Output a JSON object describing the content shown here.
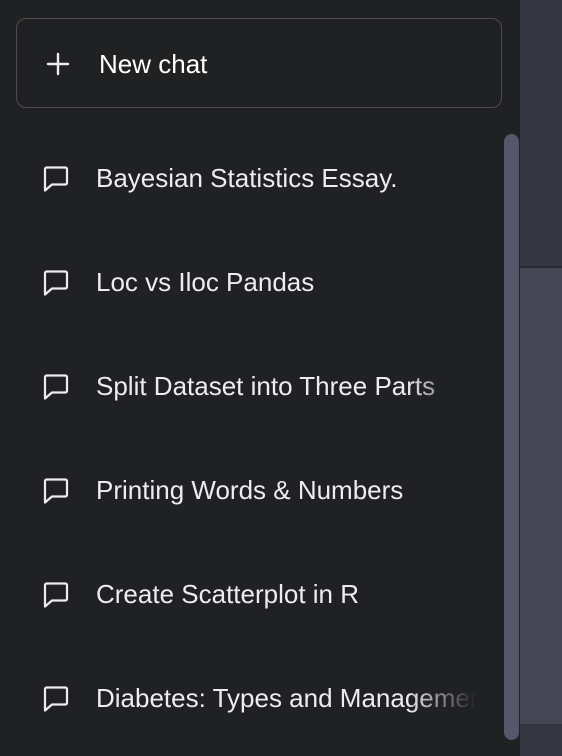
{
  "new_chat": {
    "label": "New chat",
    "icon": "plus-icon"
  },
  "history": {
    "items": [
      {
        "title": "Bayesian Statistics Essay.",
        "icon": "message-icon"
      },
      {
        "title": "Loc vs Iloc Pandas",
        "icon": "message-icon"
      },
      {
        "title": "Split Dataset into Three Parts",
        "icon": "message-icon"
      },
      {
        "title": "Printing Words & Numbers",
        "icon": "message-icon"
      },
      {
        "title": "Create Scatterplot in R",
        "icon": "message-icon"
      },
      {
        "title": "Diabetes: Types and Management",
        "icon": "message-icon"
      }
    ]
  },
  "colors": {
    "sidebar_bg": "#202123",
    "main_bg": "#343541",
    "main_alt_bg": "#444654",
    "text": "#ececf1",
    "border": "#4d4d4f",
    "scrollbar": "#565869"
  }
}
